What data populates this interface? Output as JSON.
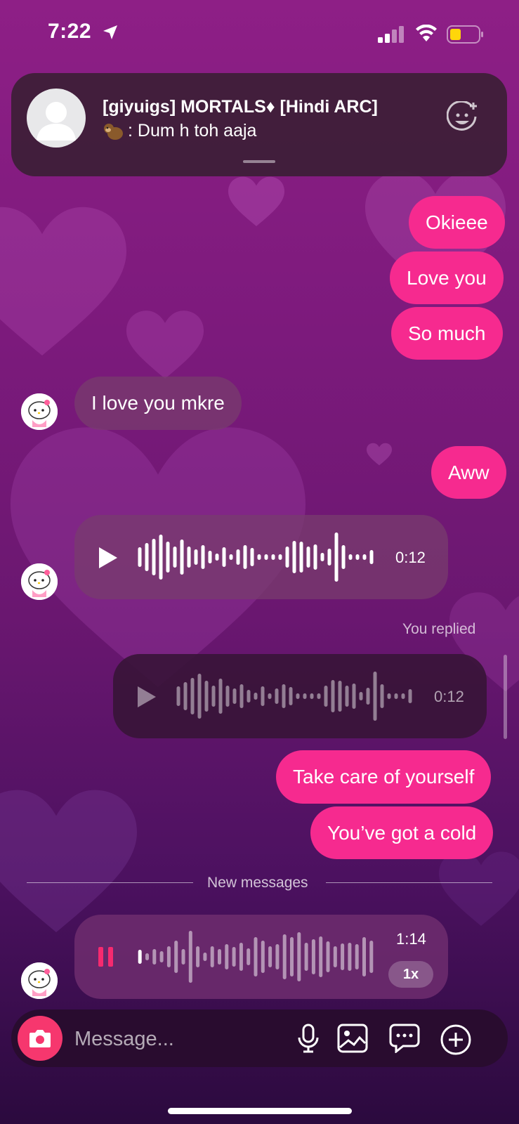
{
  "status_bar": {
    "time": "7:22",
    "icons": [
      "location-arrow-icon",
      "signal-icon",
      "wifi-icon",
      "battery-icon"
    ]
  },
  "notification": {
    "title": "[giyuigs] MORTALS♦ [Hindi ARC]",
    "body": ": Dum h toh aaja",
    "emoji_icon": "monkey-emoji-icon",
    "action_icon": "add-sticker-icon"
  },
  "messages": {
    "okieee": "Okieee",
    "love_you": "Love you",
    "so_much": "So much",
    "i_love_you": "I love you mkre",
    "aww": "Aww",
    "voice1_duration": "0:12",
    "you_replied": "You replied",
    "voice2_duration": "0:12",
    "take_care": "Take care of yourself",
    "cold": "You’ve got a cold",
    "new_messages": "New messages",
    "voice3_duration": "1:14",
    "voice3_speed": "1x"
  },
  "composer": {
    "placeholder": "Message...",
    "icons": [
      "camera-icon",
      "microphone-icon",
      "gallery-icon",
      "sticker-chat-icon",
      "plus-icon"
    ]
  },
  "colors": {
    "outgoing": "#f62a8f",
    "incoming": "#7a3c6e",
    "camera": "#f6376e",
    "pause": "#f62a6f"
  }
}
